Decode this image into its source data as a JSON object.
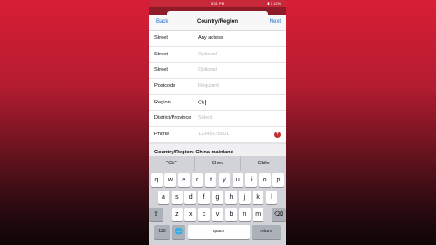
{
  "status": {
    "time": "5:31 PM",
    "right": "▮ 7 12%"
  },
  "nav": {
    "back": "Back",
    "title": "Country/Region",
    "next": "Next"
  },
  "fields": [
    {
      "label": "Street",
      "value": "Any adtess",
      "placeholder": ""
    },
    {
      "label": "Street",
      "value": "",
      "placeholder": "Optional"
    },
    {
      "label": "Street",
      "value": "",
      "placeholder": "Optional"
    },
    {
      "label": "Postcode",
      "value": "",
      "placeholder": "Required"
    },
    {
      "label": "Region",
      "value": "Ch",
      "placeholder": ""
    },
    {
      "label": "District/Province",
      "value": "",
      "placeholder": "Select"
    },
    {
      "label": "Phone",
      "value": "",
      "placeholder": "12345678901"
    }
  ],
  "country_region": "Country/Region: China mainland",
  "keyboard": {
    "suggestions": [
      "\"Ch\"",
      "Chec",
      "Chile"
    ],
    "row1": [
      "q",
      "w",
      "e",
      "r",
      "t",
      "y",
      "u",
      "i",
      "o",
      "p"
    ],
    "row2": [
      "a",
      "s",
      "d",
      "f",
      "g",
      "h",
      "j",
      "k",
      "l"
    ],
    "row3": [
      "z",
      "x",
      "c",
      "v",
      "b",
      "n",
      "m"
    ],
    "shift": "⇧",
    "delete": "⌫",
    "num": "123",
    "globe": "🌐",
    "space": "space",
    "return": "return"
  }
}
